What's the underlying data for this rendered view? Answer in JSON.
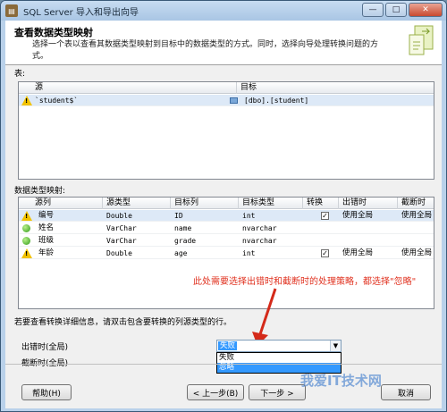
{
  "window": {
    "title": "SQL Server 导入和导出向导",
    "minimize": "—",
    "maximize": "□",
    "close": "✕"
  },
  "header": {
    "title": "查看数据类型映射",
    "description": "选择一个表以查看其数据类型映射到目标中的数据类型的方式。同时，选择向导处理转换问题的方式。"
  },
  "table_section": {
    "label": "表:",
    "columns": [
      "源",
      "目标"
    ],
    "rows": [
      {
        "status": "warning",
        "source": "`student$`",
        "target": "[dbo].[student]"
      }
    ]
  },
  "mapping_section": {
    "label": "数据类型映射:",
    "columns": [
      "源列",
      "源类型",
      "目标列",
      "目标类型",
      "转换",
      "出错时",
      "截断时"
    ],
    "rows": [
      {
        "status": "warning",
        "src_col": "编号",
        "src_type": "Double",
        "dst_col": "ID",
        "dst_type": "int",
        "convert": "✓",
        "on_error": "使用全局",
        "on_trunc": "使用全局"
      },
      {
        "status": "ok",
        "src_col": "姓名",
        "src_type": "VarChar",
        "dst_col": "name",
        "dst_type": "nvarchar",
        "convert": "",
        "on_error": "",
        "on_trunc": ""
      },
      {
        "status": "ok",
        "src_col": "班级",
        "src_type": "VarChar",
        "dst_col": "grade",
        "dst_type": "nvarchar",
        "convert": "",
        "on_error": "",
        "on_trunc": ""
      },
      {
        "status": "warning",
        "src_col": "年龄",
        "src_type": "Double",
        "dst_col": "age",
        "dst_type": "int",
        "convert": "✓",
        "on_error": "使用全局",
        "on_trunc": "使用全局"
      }
    ]
  },
  "annotation": "此处需要选择出错时和截断时的处理策略，都选择\"忽略\"",
  "hint": "若要查看转换详细信息，请双击包含要转换的列源类型的行。",
  "on_error": {
    "label": "出错时(全局)",
    "value": "失败",
    "options": [
      "失败",
      "忽略"
    ],
    "highlighted": "忽略"
  },
  "on_truncation": {
    "label": "截断时(全局)"
  },
  "buttons": {
    "help": "帮助(H)",
    "back": "< 上一步(B)",
    "next": "下一步 >",
    "cancel": "取消"
  },
  "watermark": "我爱IT技术网"
}
